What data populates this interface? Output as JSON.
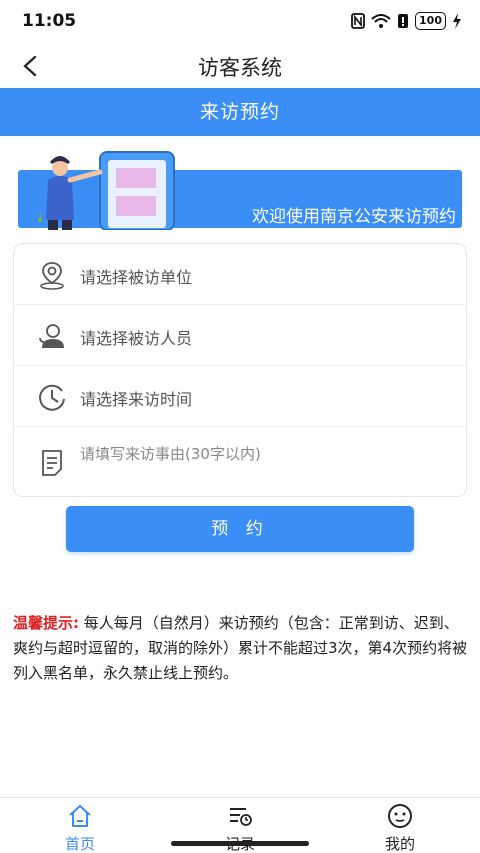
{
  "status_bar": {
    "time": "11:05",
    "battery": "100"
  },
  "nav": {
    "title": "访客系统"
  },
  "header": {
    "title": "来访预约"
  },
  "hero": {
    "welcome": "欢迎使用南京公安来访预约"
  },
  "form": {
    "unit_placeholder": "请选择被访单位",
    "person_placeholder": "请选择被访人员",
    "time_placeholder": "请选择来访时间",
    "reason_placeholder": "请填写来访事由(30字以内)"
  },
  "submit_label": "预 约",
  "notice": {
    "label": "温馨提示:",
    "text": " 每人每月（自然月）来访预约（包含：正常到访、迟到、爽约与超时逗留的，取消的除外）累计不能超过3次，第4次预约将被列入黑名单，永久禁止线上预约。"
  },
  "tabs": [
    {
      "label": "首页",
      "icon": "home-icon"
    },
    {
      "label": "记录",
      "icon": "record-icon"
    },
    {
      "label": "我的",
      "icon": "profile-icon"
    }
  ],
  "colors": {
    "accent": "#3a8ef6",
    "warning": "#e02020"
  }
}
